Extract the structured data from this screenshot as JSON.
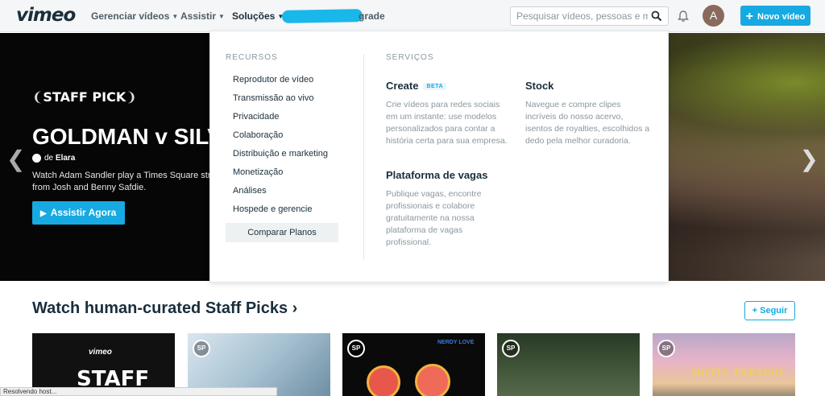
{
  "header": {
    "logo": "vimeo",
    "nav": [
      {
        "label": "Gerenciar vídeos"
      },
      {
        "label": "Assistir"
      },
      {
        "label": "Soluções"
      }
    ],
    "upgrade_partial": "grade",
    "search_placeholder": "Pesquisar vídeos, pessoas e mais",
    "avatar_initial": "A",
    "new_video_label": "Novo vídeo"
  },
  "hero": {
    "badge": "STAFF PICK",
    "title": "GOLDMAN v SILV",
    "byline_prefix": "de",
    "byline_author": "Elara",
    "description": "Watch Adam Sandler play a Times Square stre from Josh and Benny Safdie.",
    "cta": "Assistir Agora"
  },
  "dropdown": {
    "resources_caption": "RECURSOS",
    "resources": [
      "Reprodutor de vídeo",
      "Transmissão ao vivo",
      "Privacidade",
      "Colaboração",
      "Distribuição e marketing",
      "Monetização",
      "Análises",
      "Hospede e gerencie"
    ],
    "compare_plans": "Comparar Planos",
    "services_caption": "SERVIÇOS",
    "services": [
      {
        "title": "Create",
        "badge": "BETA",
        "desc": "Crie vídeos para redes sociais em um instante: use modelos personalizados para contar a história certa para sua empresa."
      },
      {
        "title": "Stock",
        "desc": "Navegue e compre clipes incríveis do nosso acervo, isentos de royalties, escolhidos a dedo pela melhor curadoria."
      },
      {
        "title": "Plataforma de vagas",
        "desc": "Publique vagas, encontre profissionais e colabore gratuitamente na nossa plataforma de vagas profissional."
      }
    ]
  },
  "section": {
    "title": "Watch human-curated Staff Picks ›",
    "follow": "Seguir",
    "thumbs": [
      {
        "badge": "SP",
        "text1": "vimeo",
        "text2": "STAFF"
      },
      {
        "badge": "SP"
      },
      {
        "badge": "SP",
        "tag": "NERDY LOVE"
      },
      {
        "badge": "SP"
      },
      {
        "badge": "SP",
        "text1": "HOTEL PARAÍSO"
      }
    ]
  },
  "status_bar": "Resolvendo host..."
}
